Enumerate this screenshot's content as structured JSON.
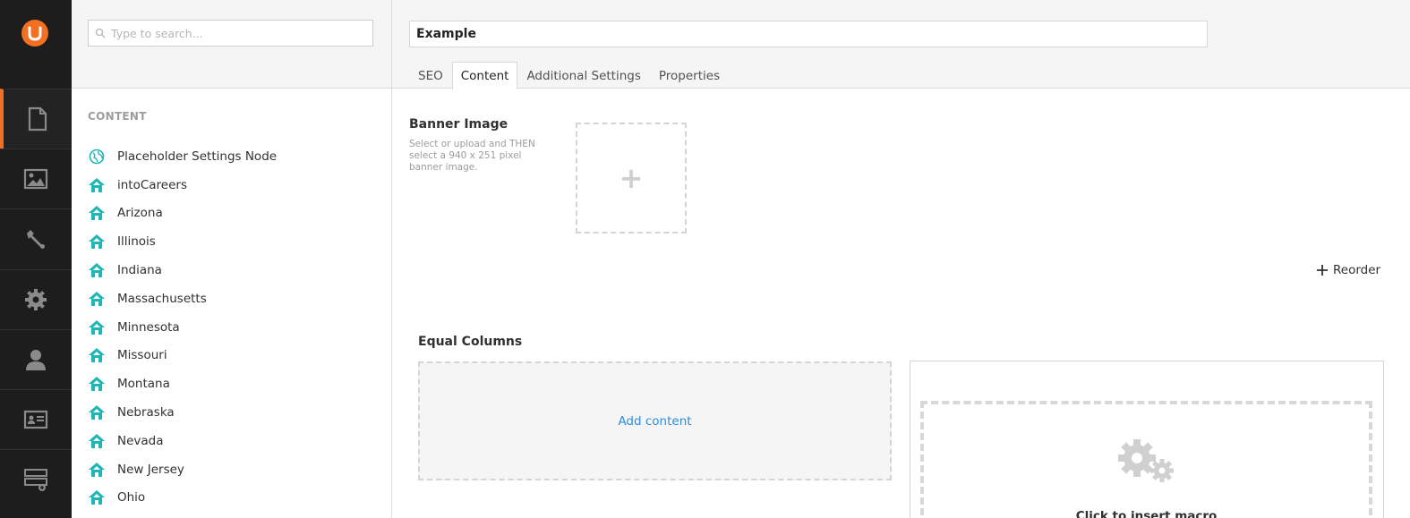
{
  "search": {
    "placeholder": "Type to search..."
  },
  "tree": {
    "section_title": "CONTENT",
    "items": [
      {
        "label": "Placeholder Settings Node",
        "icon": "globe-icon"
      },
      {
        "label": "intoCareers",
        "icon": "home-icon"
      },
      {
        "label": "Arizona",
        "icon": "home-icon"
      },
      {
        "label": "Illinois",
        "icon": "home-icon"
      },
      {
        "label": "Indiana",
        "icon": "home-icon"
      },
      {
        "label": "Massachusetts",
        "icon": "home-icon"
      },
      {
        "label": "Minnesota",
        "icon": "home-icon"
      },
      {
        "label": "Missouri",
        "icon": "home-icon"
      },
      {
        "label": "Montana",
        "icon": "home-icon"
      },
      {
        "label": "Nebraska",
        "icon": "home-icon"
      },
      {
        "label": "Nevada",
        "icon": "home-icon"
      },
      {
        "label": "New Jersey",
        "icon": "home-icon"
      },
      {
        "label": "Ohio",
        "icon": "home-icon"
      }
    ]
  },
  "nav": {
    "items": [
      {
        "name": "content",
        "icon": "document-icon",
        "active": true
      },
      {
        "name": "media",
        "icon": "image-icon",
        "active": false
      },
      {
        "name": "settings",
        "icon": "wrench-icon",
        "active": false
      },
      {
        "name": "developer",
        "icon": "gear-icon",
        "active": false
      },
      {
        "name": "users",
        "icon": "user-icon",
        "active": false
      },
      {
        "name": "members",
        "icon": "id-card-icon",
        "active": false
      },
      {
        "name": "forms",
        "icon": "forms-icon",
        "active": false
      }
    ]
  },
  "editor": {
    "name_value": "Example",
    "tabs": [
      "SEO",
      "Content",
      "Additional Settings",
      "Properties"
    ],
    "active_tab": "Content",
    "banner": {
      "label": "Banner Image",
      "description": "Select or upload and THEN select a 940 x 251 pixel banner image.",
      "add_symbol": "+"
    },
    "reorder_label": "Reorder",
    "grid": {
      "section_title": "Equal Columns",
      "add_content_label": "Add content",
      "macro_label": "Click to insert macro"
    }
  },
  "colors": {
    "accent": "#f36f21",
    "tree_icon": "#1fb6b6",
    "link": "#2e8ddb",
    "rail_bg": "#1d1d1d"
  }
}
